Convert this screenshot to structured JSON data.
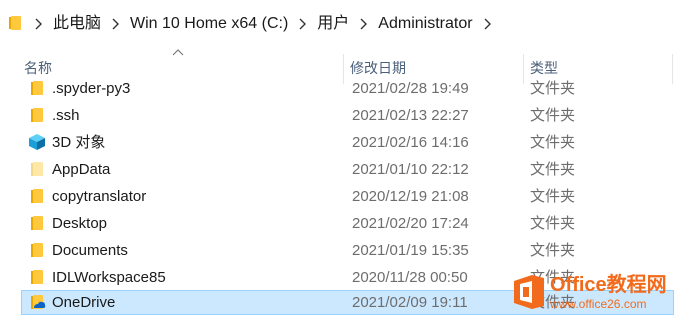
{
  "breadcrumb": {
    "items": [
      {
        "label": "此电脑"
      },
      {
        "label": "Win 10 Home x64 (C:)"
      },
      {
        "label": "用户"
      },
      {
        "label": "Administrator"
      }
    ]
  },
  "columns": {
    "name": "名称",
    "date": "修改日期",
    "type": "类型",
    "sorted_by": "name",
    "sort_direction": "ascending"
  },
  "rows": [
    {
      "name": ".spyder-py3",
      "date": "2021/02/28 19:49",
      "type": "文件夹",
      "icon": "folder-icon",
      "selected": false
    },
    {
      "name": ".ssh",
      "date": "2021/02/13 22:27",
      "type": "文件夹",
      "icon": "folder-icon",
      "selected": false
    },
    {
      "name": "3D 对象",
      "date": "2021/02/16 14:16",
      "type": "文件夹",
      "icon": "3d-objects-icon",
      "selected": false
    },
    {
      "name": "AppData",
      "date": "2021/01/10 22:12",
      "type": "文件夹",
      "icon": "hidden-folder-icon",
      "selected": false
    },
    {
      "name": "copytranslator",
      "date": "2020/12/19 21:08",
      "type": "文件夹",
      "icon": "folder-icon",
      "selected": false
    },
    {
      "name": "Desktop",
      "date": "2021/02/20 17:24",
      "type": "文件夹",
      "icon": "folder-icon",
      "selected": false
    },
    {
      "name": "Documents",
      "date": "2021/01/19 15:35",
      "type": "文件夹",
      "icon": "folder-icon",
      "selected": false
    },
    {
      "name": "IDLWorkspace85",
      "date": "2020/11/28 00:50",
      "type": "文件夹",
      "icon": "folder-icon",
      "selected": false
    },
    {
      "name": "OneDrive",
      "date": "2021/02/09 19:11",
      "type": "文件夹",
      "icon": "onedrive-folder-icon",
      "selected": true
    }
  ],
  "watermark": {
    "title": "Office教程网",
    "url": "www.office26.com"
  },
  "colors": {
    "selection_bg": "#cce8ff",
    "selection_border": "#99d1ff",
    "folder_yellow": "#ffc83d",
    "header_text": "#4c607a",
    "watermark_orange": "#f26a1b"
  }
}
